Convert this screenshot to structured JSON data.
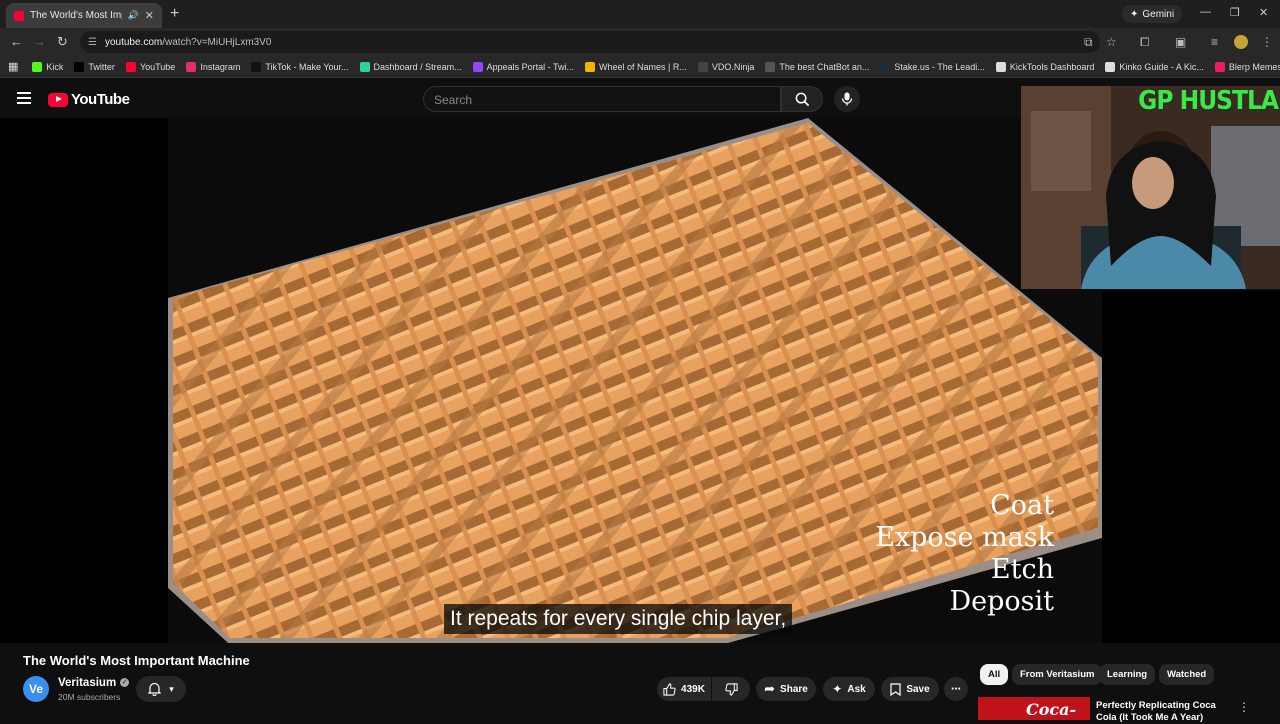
{
  "browser": {
    "tab": {
      "title": "The World's Most Importan",
      "close": "✕"
    },
    "new_tab": "+",
    "gemini": "Gemini",
    "url": {
      "host": "youtube.com",
      "path": "/watch?v=MiUHjLxm3V0"
    },
    "bookmarks": [
      {
        "label": "Kick",
        "color": "#53fc18"
      },
      {
        "label": "Twitter",
        "color": "#000000"
      },
      {
        "label": "YouTube",
        "color": "#ff0033"
      },
      {
        "label": "Instagram",
        "color": "#e1306c"
      },
      {
        "label": "TikTok - Make Your...",
        "color": "#111111"
      },
      {
        "label": "Dashboard / Stream...",
        "color": "#2fd29b"
      },
      {
        "label": "Appeals Portal - Twi...",
        "color": "#9146ff"
      },
      {
        "label": "Wheel of Names | R...",
        "color": "#f4b400"
      },
      {
        "label": "VDO.Ninja",
        "color": "#444444"
      },
      {
        "label": "The best ChatBot an...",
        "color": "#555555"
      },
      {
        "label": "Stake.us - The Leadi...",
        "color": "#1a2c38"
      },
      {
        "label": "KickTools Dashboard",
        "color": "#dddddd"
      },
      {
        "label": "Kinko Guide - A Kic...",
        "color": "#dddddd"
      },
      {
        "label": "Blerp Memes | Best...",
        "color": "#e91e63"
      }
    ]
  },
  "youtube": {
    "logo": "YouTube",
    "search_placeholder": "Search"
  },
  "video": {
    "caption": "It repeats for every single chip layer,",
    "steps": [
      "Coat",
      "Expose mask",
      "Etch",
      "Deposit"
    ],
    "webcam_tag": "GP HUSTLA",
    "title": "The World's Most Important Machine"
  },
  "channel": {
    "avatar": "Ve",
    "name": "Veritasium",
    "subscribers": "20M subscribers"
  },
  "actions": {
    "likes": "439K",
    "share": "Share",
    "ask": "Ask",
    "save": "Save"
  },
  "chips": [
    "All",
    "From Veritasium",
    "Learning",
    "Watched"
  ],
  "recommendation": {
    "title": "Perfectly Replicating Coca Cola (It Took Me A Year)",
    "thumb_text": "Coca-Cola"
  }
}
